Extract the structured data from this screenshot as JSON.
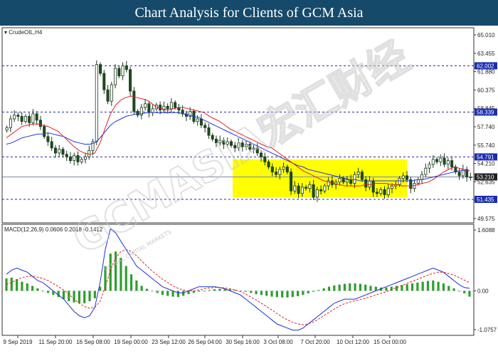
{
  "header": {
    "title": "Chart Analysis for Clients of GCM Asia"
  },
  "watermark": {
    "text": "GCMASIA宏汇财经",
    "sub": "GLOBAL CAPITAL MARKETS"
  },
  "colors": {
    "banner": "#164a6b",
    "bull": "#0f6b2a",
    "bear": "#1b4f1b",
    "ma_fast": "#e02020",
    "ma_slow": "#2233dd",
    "level_line": "#2222bb",
    "level_label": "#1a2db0",
    "current_label": "#222222",
    "zone": "#ffff00",
    "macd_hist": "#2e9e2e",
    "macd_line": "#1c2fd6",
    "signal_line": "#e02020"
  },
  "chart_data": [
    {
      "type": "candlestick",
      "symbol_label": "CrudeOIL,H4",
      "ylim": [
        49.575,
        65.01
      ],
      "y_ticks": [
        "65.010",
        "63.455",
        "61.880",
        "60.375",
        "58.845",
        "57.740",
        "55.740",
        "54.210",
        "52.635",
        "51.105",
        "49.575"
      ],
      "x_ticks": [
        "9 Sep 2019",
        "11 Sep 20:00",
        "16 Sep 08:00",
        "19 Sep 00:00",
        "23 Sep 12:00",
        "26 Sep 04:00",
        "30 Sep 16:00",
        "3 Oct 08:00",
        "7 Oct 20:00",
        "10 Oct 12:00",
        "15 Oct 00:00"
      ],
      "levels": [
        {
          "value": 62.002,
          "label": "62.002"
        },
        {
          "value": 58.339,
          "label": "58.339"
        },
        {
          "value": 54.791,
          "label": "54.791"
        },
        {
          "value": 51.435,
          "label": "51.435"
        }
      ],
      "current_price": {
        "value": 53.21,
        "label": "53.210"
      },
      "zone": {
        "from": 51.6,
        "to": 54.6,
        "start_label": "30 Sep 16:00"
      },
      "close": [
        57.1,
        57.8,
        58.1,
        58.0,
        57.6,
        58.0,
        57.5,
        58.2,
        57.7,
        57.2,
        56.4,
        56.0,
        55.5,
        55.1,
        55.4,
        55.0,
        54.8,
        54.5,
        54.9,
        54.4,
        54.6,
        54.8,
        55.3,
        56.0,
        62.1,
        61.4,
        60.1,
        59.2,
        60.5,
        61.8,
        61.2,
        62.0,
        61.7,
        60.0,
        58.4,
        58.1,
        58.7,
        59.0,
        58.3,
        58.6,
        58.9,
        58.5,
        58.8,
        58.6,
        59.1,
        58.7,
        58.5,
        58.2,
        58.0,
        58.4,
        57.6,
        57.8,
        57.3,
        57.1,
        56.5,
        56.2,
        55.9,
        56.1,
        55.8,
        56.0,
        55.7,
        55.5,
        55.9,
        55.6,
        55.8,
        55.4,
        55.5,
        55.1,
        54.8,
        54.4,
        54.0,
        53.6,
        53.4,
        53.8,
        54.0,
        53.6,
        52.1,
        52.5,
        51.9,
        52.4,
        52.3,
        52.6,
        51.6,
        52.2,
        52.1,
        52.5,
        52.9,
        52.6,
        52.8,
        53.1,
        52.8,
        53.0,
        52.7,
        53.4,
        53.6,
        53.0,
        52.4,
        52.9,
        52.0,
        51.9,
        52.2,
        51.8,
        52.3,
        52.5,
        52.6,
        53.1,
        53.3,
        53.0,
        52.3,
        52.7,
        53.0,
        53.4,
        53.9,
        54.2,
        54.6,
        54.4,
        54.7,
        54.2,
        54.5,
        54.0,
        53.6,
        53.3,
        53.8,
        53.2,
        53.21
      ],
      "ma_fast": [
        56.3,
        56.6,
        56.9,
        57.2,
        57.3,
        57.4,
        57.4,
        57.3,
        57.2,
        57.0,
        56.8,
        56.4,
        56.0,
        55.6,
        55.3,
        55.1,
        55.0,
        55.1,
        55.9,
        57.1,
        58.2,
        58.9,
        59.3,
        59.5,
        59.6,
        59.5,
        59.4,
        59.3,
        59.0,
        58.7,
        58.6,
        58.5,
        58.6,
        58.7,
        58.7,
        58.6,
        58.5,
        58.4,
        58.3,
        58.0,
        57.8,
        57.6,
        57.3,
        57.0,
        56.8,
        56.6,
        56.4,
        56.2,
        56.0,
        55.8,
        55.6,
        55.5,
        55.2,
        54.9,
        54.6,
        54.3,
        54.0,
        53.7,
        53.5,
        53.3,
        53.1,
        52.9,
        52.8,
        52.7,
        52.6,
        52.5,
        52.5,
        52.5,
        52.5,
        52.6,
        52.6,
        52.7,
        52.7,
        52.7,
        52.6,
        52.6,
        52.5,
        52.5,
        52.5,
        52.6,
        52.7,
        52.8,
        53.0,
        53.3,
        53.6,
        53.8,
        54.0,
        53.9,
        53.8,
        53.7
      ],
      "ma_slow": [
        55.8,
        55.9,
        56.1,
        56.3,
        56.4,
        56.5,
        56.6,
        56.6,
        56.7,
        56.6,
        56.5,
        56.4,
        56.2,
        56.0,
        55.9,
        55.8,
        55.8,
        55.9,
        56.3,
        56.8,
        57.3,
        57.6,
        57.8,
        58.0,
        58.1,
        58.2,
        58.2,
        58.3,
        58.3,
        58.3,
        58.3,
        58.3,
        58.3,
        58.3,
        58.2,
        58.1,
        58.0,
        57.9,
        57.7,
        57.5,
        57.3,
        57.1,
        56.9,
        56.7,
        56.5,
        56.3,
        56.1,
        55.9,
        55.7,
        55.5,
        55.3,
        55.1,
        54.9,
        54.7,
        54.5,
        54.3,
        54.1,
        54.0,
        53.8,
        53.7,
        53.6,
        53.5,
        53.4,
        53.3,
        53.2,
        53.1,
        53.0,
        53.0,
        52.9,
        52.9,
        52.9,
        52.9,
        52.9,
        52.9,
        52.9,
        52.9,
        52.9,
        52.9,
        52.9,
        53.0,
        53.0,
        53.1,
        53.2,
        53.3,
        53.4,
        53.5,
        53.6,
        53.7,
        53.7,
        53.7
      ]
    },
    {
      "type": "macd",
      "label": "MACD(12,26,9) 0.0606 0.2018 -0.1412",
      "ylim": [
        -1.0757,
        1.6088
      ],
      "y_ticks": [
        "1.6088",
        "0.00",
        "-1.0757"
      ],
      "histogram": [
        0.3,
        0.32,
        0.28,
        0.22,
        0.18,
        0.12,
        0.06,
        0.0,
        -0.05,
        -0.1,
        -0.15,
        -0.2,
        -0.25,
        -0.28,
        -0.3,
        -0.3,
        -0.25,
        -0.18,
        0.1,
        0.6,
        0.9,
        0.95,
        0.8,
        0.6,
        0.4,
        0.25,
        0.12,
        0.05,
        0.0,
        -0.05,
        -0.1,
        -0.12,
        -0.14,
        -0.15,
        -0.12,
        -0.08,
        -0.05,
        -0.02,
        0.0,
        0.02,
        0.04,
        0.05,
        0.05,
        0.04,
        0.02,
        0.0,
        -0.02,
        -0.05,
        -0.08,
        -0.1,
        -0.12,
        -0.14,
        -0.15,
        -0.16,
        -0.16,
        -0.15,
        -0.13,
        -0.1,
        -0.06,
        -0.02,
        0.02,
        0.06,
        0.1,
        0.13,
        0.15,
        0.17,
        0.18,
        0.18,
        0.17,
        0.15,
        0.12,
        0.1,
        0.08,
        0.08,
        0.1,
        0.12,
        0.14,
        0.16,
        0.18,
        0.2,
        0.22,
        0.24,
        0.25,
        0.22,
        0.18,
        0.12,
        0.06,
        0.0,
        -0.06,
        -0.14
      ],
      "macd": [
        0.4,
        0.5,
        0.55,
        0.5,
        0.45,
        0.35,
        0.25,
        0.2,
        0.1,
        0.0,
        -0.1,
        -0.2,
        -0.35,
        -0.5,
        -0.6,
        -0.65,
        -0.6,
        -0.4,
        0.2,
        1.0,
        1.5,
        1.4,
        1.2,
        1.0,
        0.8,
        0.6,
        0.5,
        0.4,
        0.3,
        0.2,
        0.1,
        0.05,
        0.0,
        -0.05,
        -0.05,
        0.0,
        0.05,
        0.1,
        0.1,
        0.1,
        0.1,
        0.08,
        0.05,
        0.0,
        -0.05,
        -0.1,
        -0.2,
        -0.3,
        -0.4,
        -0.5,
        -0.6,
        -0.7,
        -0.8,
        -0.85,
        -0.9,
        -0.95,
        -0.95,
        -0.9,
        -0.8,
        -0.7,
        -0.6,
        -0.5,
        -0.4,
        -0.3,
        -0.25,
        -0.2,
        -0.2,
        -0.2,
        -0.15,
        -0.1,
        -0.05,
        0.0,
        0.05,
        0.1,
        0.15,
        0.2,
        0.25,
        0.3,
        0.35,
        0.4,
        0.45,
        0.5,
        0.55,
        0.5,
        0.45,
        0.35,
        0.25,
        0.15,
        0.08,
        0.06
      ],
      "signal": [
        0.15,
        0.2,
        0.27,
        0.32,
        0.35,
        0.36,
        0.33,
        0.3,
        0.25,
        0.18,
        0.1,
        0.02,
        -0.08,
        -0.2,
        -0.3,
        -0.38,
        -0.42,
        -0.4,
        -0.25,
        0.1,
        0.5,
        0.8,
        0.95,
        1.0,
        0.95,
        0.85,
        0.72,
        0.6,
        0.48,
        0.38,
        0.28,
        0.2,
        0.12,
        0.06,
        0.02,
        0.0,
        0.0,
        0.02,
        0.05,
        0.07,
        0.08,
        0.08,
        0.07,
        0.05,
        0.02,
        -0.02,
        -0.08,
        -0.15,
        -0.22,
        -0.3,
        -0.38,
        -0.46,
        -0.55,
        -0.63,
        -0.7,
        -0.76,
        -0.8,
        -0.82,
        -0.8,
        -0.75,
        -0.68,
        -0.6,
        -0.52,
        -0.44,
        -0.37,
        -0.31,
        -0.27,
        -0.24,
        -0.21,
        -0.18,
        -0.14,
        -0.1,
        -0.06,
        -0.02,
        0.03,
        0.08,
        0.13,
        0.18,
        0.23,
        0.28,
        0.33,
        0.38,
        0.42,
        0.45,
        0.45,
        0.42,
        0.38,
        0.32,
        0.26,
        0.2
      ]
    }
  ]
}
